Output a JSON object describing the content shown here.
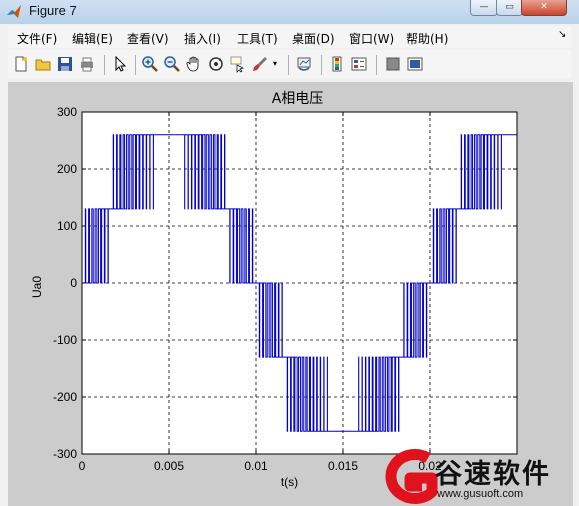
{
  "window": {
    "title": "Figure 7",
    "close_glyph": "✕",
    "minimize_glyph": "—",
    "maximize_glyph": "▭"
  },
  "menu": {
    "items": [
      "文件(F)",
      "编辑(E)",
      "查看(V)",
      "插入(I)",
      "工具(T)",
      "桌面(D)",
      "窗口(W)",
      "帮助(H)"
    ],
    "dock_glyph": "↘"
  },
  "toolbar": {
    "icons": [
      "new-figure-icon",
      "open-file-icon",
      "save-icon",
      "print-icon",
      "select-arrow-icon",
      "zoom-in-icon",
      "zoom-out-icon",
      "pan-hand-icon",
      "rotate-3d-icon",
      "data-cursor-icon",
      "brush-icon",
      "brush-dropdown-icon",
      "link-plot-icon",
      "insert-colorbar-icon",
      "insert-legend-icon",
      "hide-plot-tools-icon",
      "show-plot-tools-icon"
    ]
  },
  "watermark": {
    "brand": "谷速软件",
    "url": "www.gusuoft.com",
    "logo_color": "#e0121b"
  },
  "chart_data": {
    "type": "line",
    "title": "A相电压",
    "xlabel": "t(s)",
    "ylabel": "Ua0",
    "xlim": [
      0,
      0.025
    ],
    "ylim": [
      -300,
      300
    ],
    "xticks": [
      0,
      0.005,
      0.01,
      0.015,
      0.02
    ],
    "xtick_labels": [
      "0",
      "0.005",
      "0.01",
      "0.015",
      "0.02"
    ],
    "yticks": [
      -300,
      -200,
      -100,
      0,
      100,
      200,
      300
    ],
    "ytick_labels": [
      "-300",
      "-200",
      "-100",
      "0",
      "100",
      "200",
      "300"
    ],
    "grid": true,
    "grid_style": "dashed",
    "line_color": "#0000c8",
    "levels": [
      -260,
      -130,
      0,
      130,
      260
    ],
    "carrier_period": 0.0002,
    "fundamental_period": 0.02,
    "modulation_amplitude": 2.05,
    "series": [
      {
        "name": "",
        "waveform": "five-level PWM staircase"
      }
    ]
  }
}
